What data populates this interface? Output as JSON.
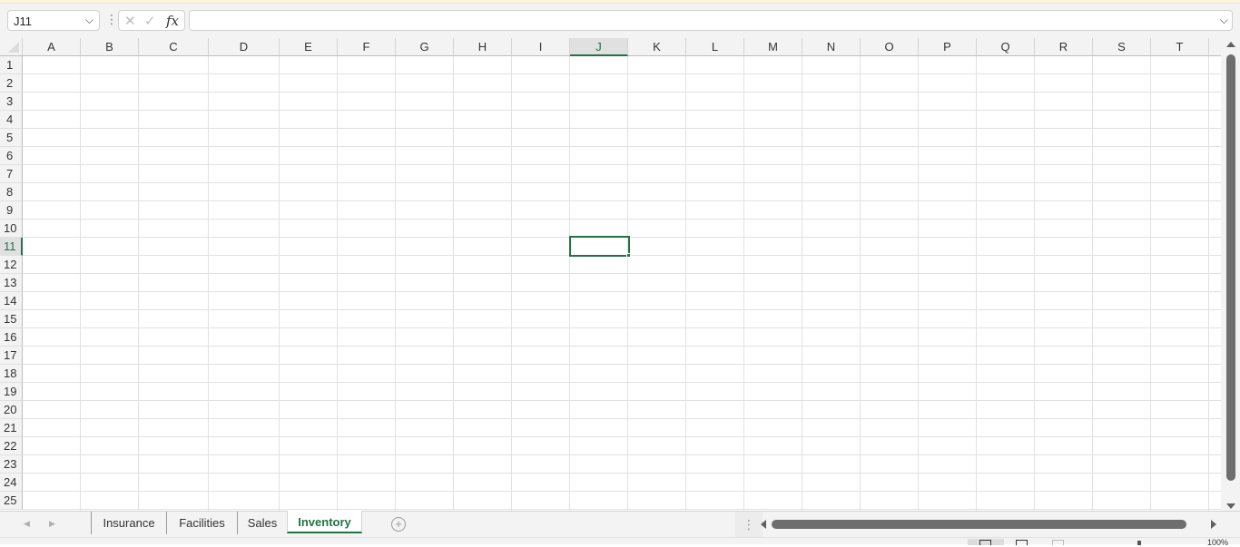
{
  "formula_bar": {
    "name_box_value": "J11",
    "name_box_dropdown_icon": "chevron-down-icon",
    "more_icon": "vertical-ellipsis-icon",
    "cancel_icon": "close-icon",
    "enter_icon": "check-icon",
    "insert_function_label": "fx",
    "formula_value": "",
    "expand_icon": "chevron-down-icon"
  },
  "grid": {
    "columns": [
      "A",
      "B",
      "C",
      "D",
      "E",
      "F",
      "G",
      "H",
      "I",
      "J",
      "K",
      "L",
      "M",
      "N",
      "O",
      "P",
      "Q",
      "R",
      "S",
      "T"
    ],
    "rows": [
      "1",
      "2",
      "3",
      "4",
      "5",
      "6",
      "7",
      "8",
      "9",
      "10",
      "11",
      "12",
      "13",
      "14",
      "15",
      "16",
      "17",
      "18",
      "19",
      "20",
      "21",
      "22",
      "23",
      "24",
      "25"
    ],
    "active_cell": "J11",
    "active_column": "J",
    "active_row": "11",
    "accent_color": "#217346"
  },
  "sheet_tabs": {
    "tabs": [
      {
        "label": "Insurance",
        "active": false
      },
      {
        "label": "Facilities",
        "active": false
      },
      {
        "label": "Sales",
        "active": false
      },
      {
        "label": "Inventory",
        "active": true
      }
    ],
    "add_sheet_icon": "plus-circle-icon",
    "prev_icon": "chevron-left-icon",
    "next_icon": "chevron-right-icon",
    "add_symbol": "+",
    "dots_symbol": "⋮"
  },
  "status_bar": {
    "zoom_label": "100%"
  }
}
